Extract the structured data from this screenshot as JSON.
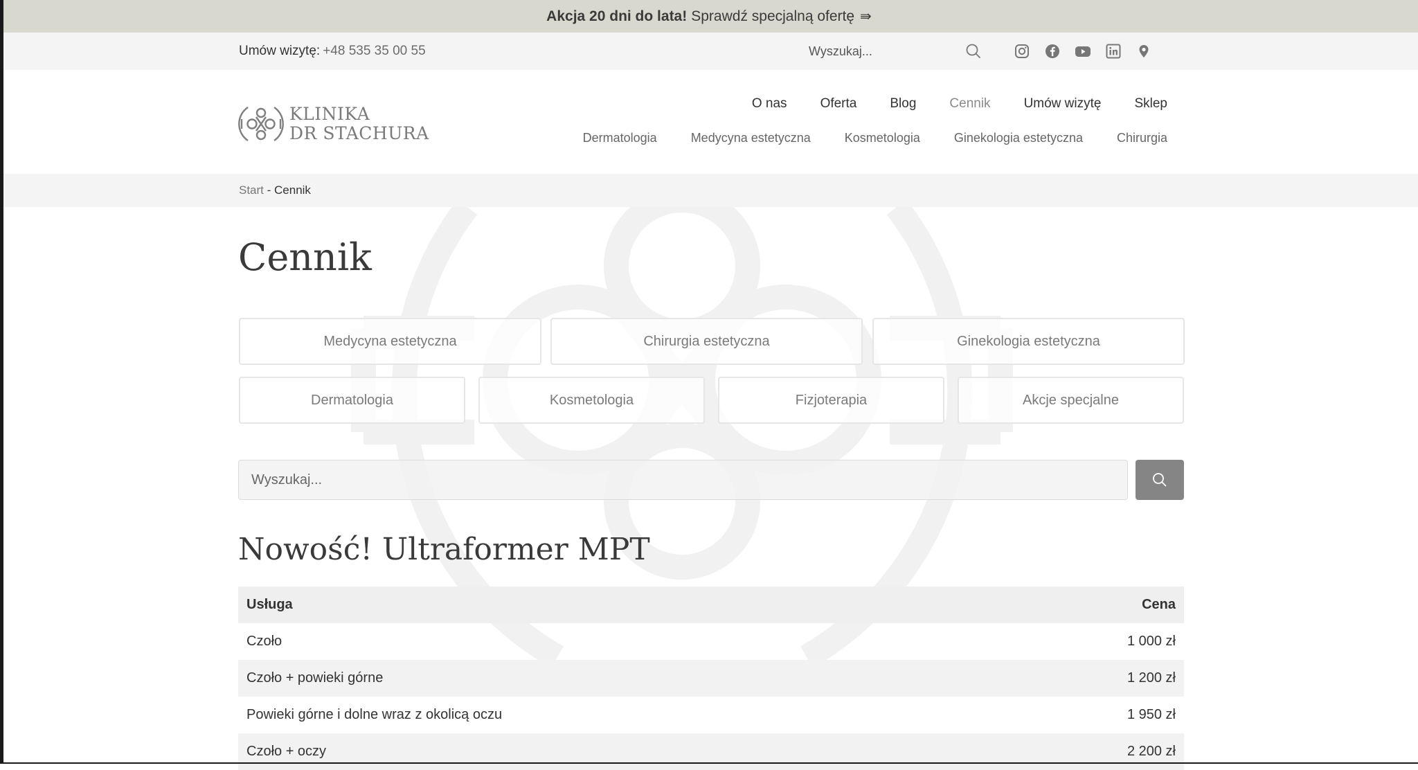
{
  "promo": {
    "bold": "Akcja 20 dni do lata!",
    "text": "Sprawdź specjalną ofertę",
    "arrow": "⇛"
  },
  "topbar": {
    "phone_label": "Umów wizytę:",
    "phone_number": "+48 535 35 00 55",
    "search_placeholder": "Wyszukaj...",
    "socials": [
      "instagram-icon",
      "facebook-icon",
      "youtube-icon",
      "linkedin-icon",
      "map-pin-icon"
    ]
  },
  "logo": {
    "line1": "KLINIKA",
    "line2": "DR STACHURA"
  },
  "mainnav": [
    "O nas",
    "Oferta",
    "Blog",
    "Cennik",
    "Umów wizytę",
    "Sklep"
  ],
  "mainnav_active": "Cennik",
  "subnav": [
    "Dermatologia",
    "Medycyna estetyczna",
    "Kosmetologia",
    "Ginekologia estetyczna",
    "Chirurgia"
  ],
  "breadcrumb": {
    "home": "Start",
    "separator": " - ",
    "current": "Cennik"
  },
  "page_title": "Cennik",
  "categories_row1": [
    "Medycyna estetyczna",
    "Chirurgia estetyczna",
    "Ginekologia estetyczna"
  ],
  "categories_row2": [
    "Dermatologia",
    "Kosmetologia",
    "Fizjoterapia",
    "Akcje specjalne"
  ],
  "search": {
    "placeholder": "Wyszukaj..."
  },
  "section": {
    "title": "Nowość! Ultraformer MPT",
    "headers": {
      "service": "Usługa",
      "price": "Cena"
    },
    "rows": [
      {
        "service": "Czoło",
        "price": "1 000 zł"
      },
      {
        "service": "Czoło + powieki górne",
        "price": "1 200 zł"
      },
      {
        "service": "Powieki górne i dolne wraz z okolicą oczu",
        "price": "1 950 zł"
      },
      {
        "service": "Czoło + oczy",
        "price": "2 200 zł"
      }
    ]
  },
  "colors": {
    "promo_bg": "#d9d8ce",
    "bar_bg": "#f4f4f4",
    "search_btn": "#858585",
    "text": "#333333"
  }
}
